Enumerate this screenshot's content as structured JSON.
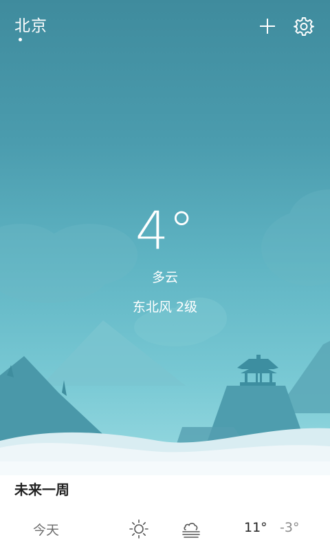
{
  "header": {
    "city": "北京",
    "add_icon": "plus-icon",
    "settings_icon": "gear-icon"
  },
  "current": {
    "temperature": "4°",
    "condition": "多云",
    "wind": "东北风 2级"
  },
  "forecast": {
    "title": "未来一周",
    "days": [
      {
        "label": "今天",
        "day_icon": "sun-icon",
        "night_icon": "fog-icon",
        "high": "11°",
        "low": "-3°"
      }
    ]
  },
  "colors": {
    "sky_top": "#3f8b9d",
    "sky_bottom": "#9adbe2",
    "text_primary": "#222222",
    "text_secondary": "#6c6c6c"
  }
}
